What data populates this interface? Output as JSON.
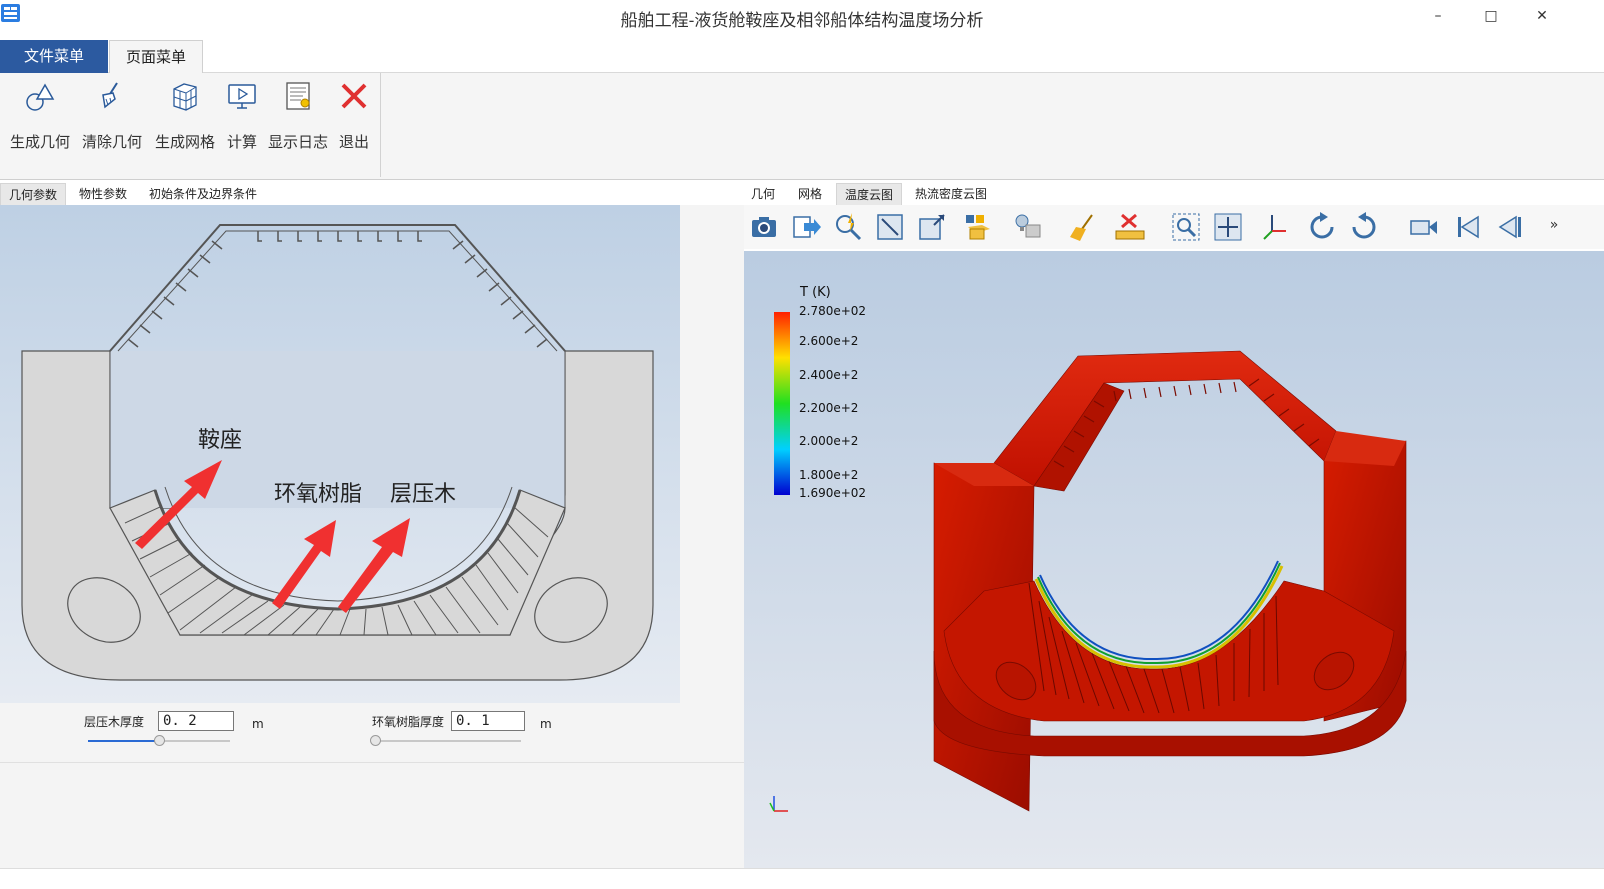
{
  "window": {
    "title": "船舶工程-液货舱鞍座及相邻船体结构温度场分析",
    "minimize": "–",
    "maximize": "□",
    "close": "✕"
  },
  "menu_tabs": [
    {
      "label": "文件菜单"
    },
    {
      "label": "页面菜单"
    }
  ],
  "ribbon": [
    {
      "label": "生成几何",
      "icon": "geometry-icon"
    },
    {
      "label": "清除几何",
      "icon": "broom-icon"
    },
    {
      "label": "生成网格",
      "icon": "mesh-cube-icon"
    },
    {
      "label": "计算",
      "icon": "monitor-play-icon"
    },
    {
      "label": "显示日志",
      "icon": "log-icon"
    },
    {
      "label": "退出",
      "icon": "red-x-icon"
    }
  ],
  "left_tabs": [
    {
      "label": "几何参数"
    },
    {
      "label": "物性参数"
    },
    {
      "label": "初始条件及边界条件"
    }
  ],
  "right_tabs": [
    {
      "label": "几何"
    },
    {
      "label": "网格"
    },
    {
      "label": "温度云图"
    },
    {
      "label": "热流密度云图"
    }
  ],
  "diagram": {
    "annotation_saddle": "鞍座",
    "annotation_epoxy": "环氧树脂",
    "annotation_laminated_wood": "层压木"
  },
  "params": {
    "laminated_wood_label": "层压木厚度",
    "laminated_wood_value": "0. 2",
    "laminated_wood_unit": "m",
    "laminated_wood_slider_fraction": 0.5,
    "epoxy_label": "环氧树脂厚度",
    "epoxy_value": "0. 1",
    "epoxy_unit": "m",
    "epoxy_slider_fraction": 0.0
  },
  "toolbar_icons": [
    "camera-icon",
    "export-icon",
    "probe-icon",
    "fit-icon",
    "box-icon",
    "color-by-icon",
    "light-icon",
    "broom-icon",
    "ruler-icon",
    "zoom-box-icon",
    "reset-view-icon",
    "axes-icon",
    "rotate-cw-icon",
    "rotate-ccw-icon",
    "record-icon",
    "first-frame-icon",
    "prev-frame-icon",
    "more-icon"
  ],
  "colorbar": {
    "title": "T (K)",
    "ticks": [
      "2.780e+02",
      "2.600e+2",
      "2.400e+2",
      "2.200e+2",
      "2.000e+2",
      "1.800e+2",
      "1.690e+02"
    ],
    "colors": {
      "max": "#ff2000",
      "mid_high": "#ffe000",
      "mid": "#20e020",
      "mid_low": "#00d0ff",
      "min": "#0000d0"
    }
  },
  "model_color": "#cc1400",
  "accent": "#2c5aa0"
}
